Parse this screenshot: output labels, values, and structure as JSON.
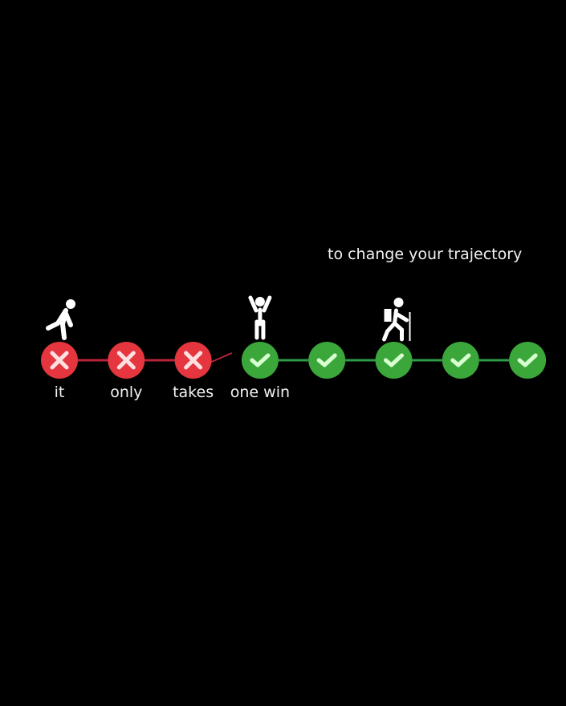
{
  "headline": "to change your trajectory",
  "colors": {
    "fail": "#e5363f",
    "success": "#3ba73a",
    "fail_line": "#b8243a",
    "success_line": "#2f9a4a",
    "mark_fail": "#ffe0e0",
    "mark_success": "#d8ffd0"
  },
  "steps": [
    {
      "status": "fail",
      "label": "it",
      "figure": "tired-person-icon"
    },
    {
      "status": "fail",
      "label": "only"
    },
    {
      "status": "fail",
      "label": "takes"
    },
    {
      "status": "success",
      "label": "one win",
      "figure": "celebrating-person-icon"
    },
    {
      "status": "success"
    },
    {
      "status": "success",
      "figure": "hiker-icon"
    },
    {
      "status": "success"
    },
    {
      "status": "success"
    }
  ]
}
